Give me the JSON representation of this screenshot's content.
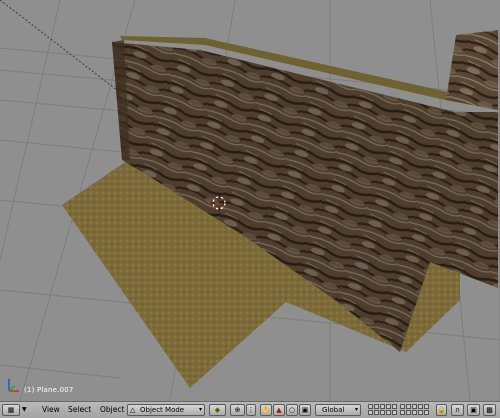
{
  "viewport": {
    "object_label": "(1) Plane.007"
  },
  "header": {
    "menus": [
      "View",
      "Select",
      "Object"
    ],
    "mode": "Object Mode",
    "orientation": "Global"
  },
  "icons": {
    "editor_type": "view3d-icon",
    "shading": "solid-shading-icon",
    "pivot": "pivot-icon",
    "manipulator": "hand-icon",
    "translate": "translate-icon",
    "rotate": "rotate-icon",
    "scale": "scale-icon",
    "lock": "lock-icon",
    "render": "render-icon"
  },
  "colors": {
    "viewport_bg": "#8f8f8f",
    "header_bg": "#b0b0b0",
    "ground": "#7a6a3a",
    "wall": "#5e4a38"
  }
}
